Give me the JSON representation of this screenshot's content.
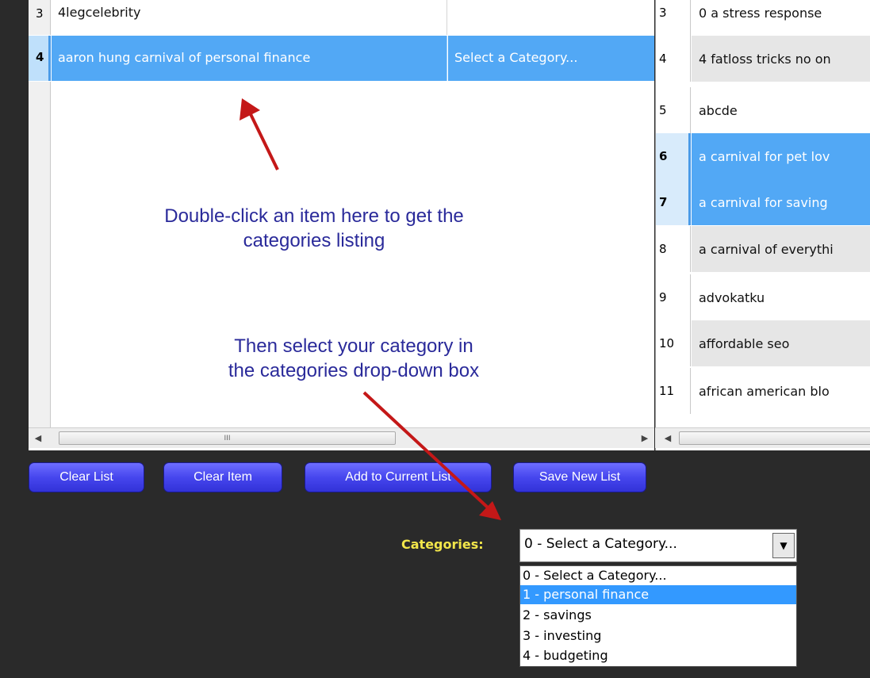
{
  "left_grid": {
    "rows": [
      {
        "num": "3",
        "name": "4legcelebrity",
        "category": ""
      },
      {
        "num": "4",
        "name": "aaron hung carnival of personal finance",
        "category": "Select a Category..."
      }
    ]
  },
  "annotations": {
    "double_click": [
      "Double-click an item here to get the",
      "categories listing"
    ],
    "select_category": [
      "Then select your category in",
      "the categories drop-down box"
    ]
  },
  "right_grid": {
    "rows": [
      {
        "num": "3",
        "name": "0 a stress response",
        "style": "normal"
      },
      {
        "num": "4",
        "name": "4 fatloss tricks no on",
        "style": "alt"
      },
      {
        "num": "5",
        "name": "abcde",
        "style": "normal"
      },
      {
        "num": "6",
        "name": "a carnival for pet lov",
        "style": "selected"
      },
      {
        "num": "7",
        "name": "a carnival for saving",
        "style": "selected"
      },
      {
        "num": "8",
        "name": "a carnival of everythi",
        "style": "alt"
      },
      {
        "num": "9",
        "name": "advokatku",
        "style": "normal"
      },
      {
        "num": "10",
        "name": "affordable seo",
        "style": "alt"
      },
      {
        "num": "11",
        "name": "african american blo",
        "style": "normal"
      }
    ]
  },
  "buttons": {
    "clear_list": "Clear List",
    "clear_item": "Clear Item",
    "add_to_current_list": "Add to Current List",
    "save_new_list": "Save New List"
  },
  "categories": {
    "label": "Categories:",
    "selected": "0 - Select a Category...",
    "options": [
      "0 - Select a Category...",
      "1 - personal finance",
      "2 - savings",
      "3 - investing",
      "4 - budgeting"
    ],
    "highlighted_index": 1
  },
  "scrollbar": {
    "grip": "III"
  },
  "colors": {
    "background": "#2a2a2a",
    "selection": "#52a8f5",
    "button": "#4646ee",
    "label": "#f2e64a",
    "annotation_text": "#2a2a9a",
    "arrow": "#c41818"
  }
}
